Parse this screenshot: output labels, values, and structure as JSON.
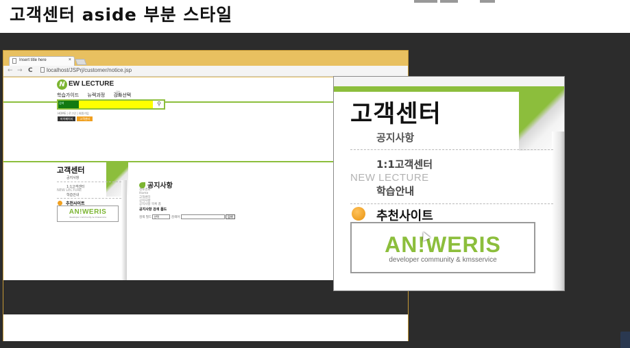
{
  "slide": {
    "title": "고객센터 aside 부분 스타일"
  },
  "browser": {
    "tab_title": "Insert title here",
    "tab_close": "×",
    "back": "←",
    "forward": "→",
    "reload": "C",
    "url": "localhost/JSPrj/customer/notice.jsp"
  },
  "site": {
    "logo_letter": "N",
    "logo_text": "EW LECTURE",
    "logo_sub": "ON-LINE",
    "menu": [
      "학습가이드",
      "뉴렉과정",
      "강좌선택"
    ],
    "search_label": "검색",
    "search_button_icon": "magnifier-icon",
    "search_button": "⚲",
    "breadcrumb": "HOME | 로그인 | 회원가입",
    "btn_mypage": "마이페이지",
    "btn_service": "고객센터",
    "aside": {
      "title": "고객센터",
      "items": [
        "공지사항",
        "1:1고객센터",
        "NEW LECTURE",
        "학습안내"
      ],
      "recommend": "추천사이트",
      "ad_logo": "AN!WERIS",
      "ad_sub": "developer community & kmsservice"
    },
    "main": {
      "title": "공지사항",
      "path_label": "경로경로",
      "path": [
        "Home",
        "고객센터",
        "공지사항",
        "공지사항 목록 폼"
      ],
      "search_form_title": "공지사항 검색 폼드",
      "field_label": "검색 필드",
      "select_value": "선택",
      "keyword_label": "검색어",
      "search_button": "검색"
    }
  },
  "zoom": {
    "title": "고객센터",
    "item1": "공지사항",
    "item2": "1:1고객센터",
    "overlay": "NEW LECTURE",
    "item3": "학습안내",
    "recommend": "추천사이트",
    "ad_logo": "AN!WERIS",
    "ad_sub": "developer community & kmsservice"
  }
}
